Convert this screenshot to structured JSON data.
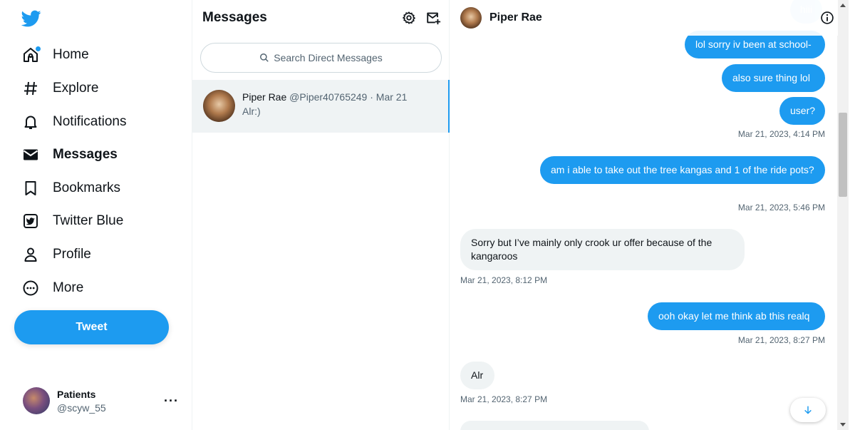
{
  "nav": {
    "items": [
      {
        "label": "Home",
        "icon": "home-icon",
        "active": false
      },
      {
        "label": "Explore",
        "icon": "hashtag-icon",
        "active": false
      },
      {
        "label": "Notifications",
        "icon": "bell-icon",
        "active": false
      },
      {
        "label": "Messages",
        "icon": "envelope-icon",
        "active": true
      },
      {
        "label": "Bookmarks",
        "icon": "bookmark-icon",
        "active": false
      },
      {
        "label": "Twitter Blue",
        "icon": "twitter-blue-icon",
        "active": false
      },
      {
        "label": "Profile",
        "icon": "person-icon",
        "active": false
      },
      {
        "label": "More",
        "icon": "more-circle-icon",
        "active": false
      }
    ],
    "tweet_label": "Tweet",
    "account": {
      "name": "Patients",
      "handle": "@scyw_55",
      "more": "···"
    }
  },
  "messages": {
    "title": "Messages",
    "search_placeholder": "Search Direct Messages",
    "conversations": [
      {
        "name": "Piper Rae",
        "meta": "@Piper40765249 · Mar 21",
        "preview": "Alr:)"
      }
    ]
  },
  "chat": {
    "partner_name": "Piper Rae",
    "messages": [
      {
        "text": "hiii",
        "dir": "out"
      },
      {
        "text": "lol sorry iv been at school-",
        "dir": "out"
      },
      {
        "text": "also sure thing  lol",
        "dir": "out"
      },
      {
        "text": "user?",
        "dir": "out"
      },
      {
        "text": "am i able to take out the tree kangas and 1 of the ride pots?",
        "dir": "out"
      },
      {
        "text": "Sorry but I’ve mainly only crook ur offer because of the kangaroos",
        "dir": "in"
      },
      {
        "text": "ooh okay let me think ab this realq",
        "dir": "out"
      },
      {
        "text": "Alr",
        "dir": "in"
      }
    ],
    "timestamps": [
      "Mar 21, 2023, 4:14 PM",
      "Mar 21, 2023, 5:46 PM",
      "Mar 21, 2023, 8:12 PM",
      "Mar 21, 2023, 8:27 PM",
      "Mar 21, 2023, 8:27 PM"
    ]
  },
  "colors": {
    "accent": "#1d9bf0",
    "incoming_bubble": "#eff3f4",
    "text": "#0f1419",
    "muted": "#536471"
  }
}
